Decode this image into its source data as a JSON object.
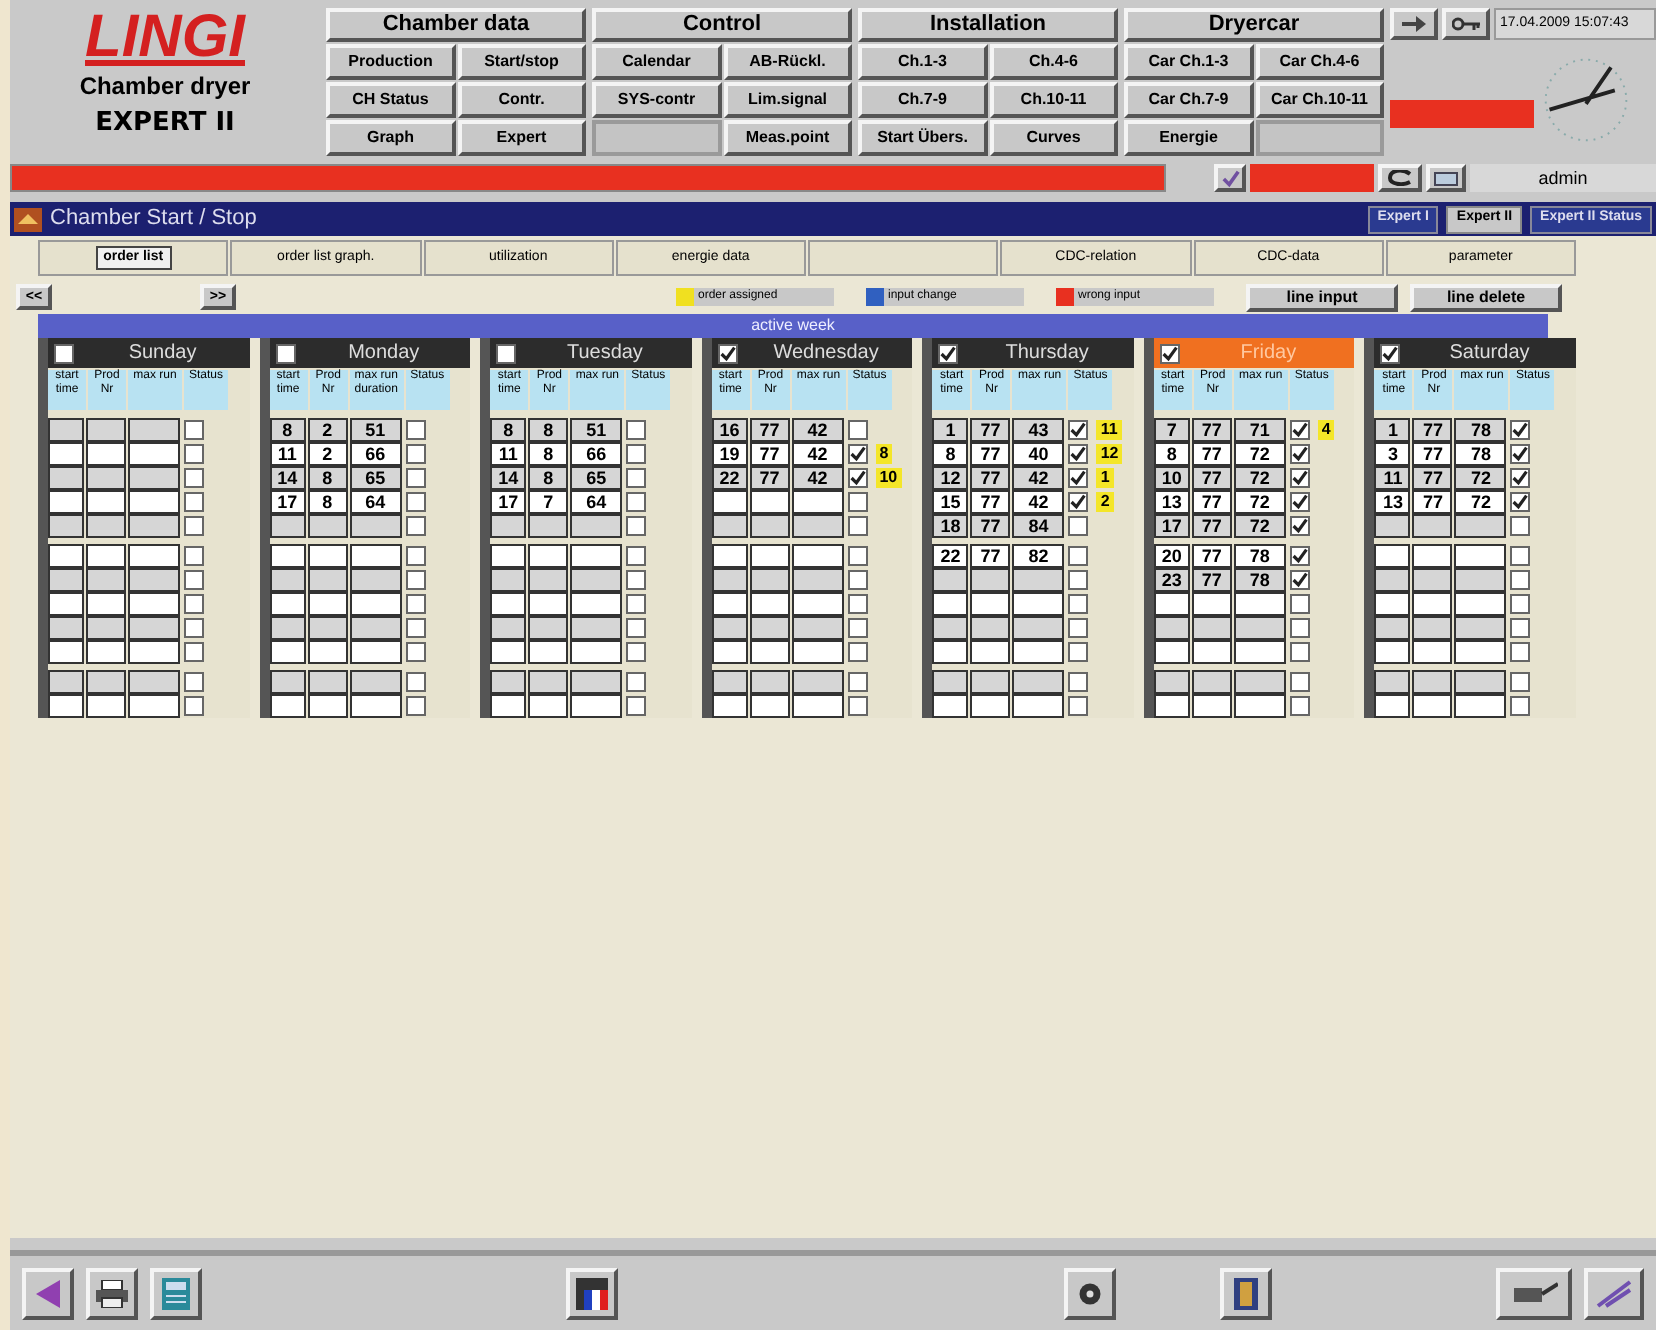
{
  "logo": {
    "brand": "LINGI",
    "subtitle": "Chamber dryer",
    "product": "EXPERT II"
  },
  "menu_groups": [
    {
      "title": "Chamber data",
      "buttons": [
        {
          "label": "Production",
          "disabled": false
        },
        {
          "label": "Start/stop",
          "disabled": false
        },
        {
          "label": "CH Status",
          "disabled": false
        },
        {
          "label": "Contr.",
          "disabled": false
        },
        {
          "label": "Graph",
          "disabled": false
        },
        {
          "label": "Expert",
          "disabled": false
        }
      ]
    },
    {
      "title": "Control",
      "buttons": [
        {
          "label": "Calendar",
          "disabled": false
        },
        {
          "label": "AB-Rückl.",
          "disabled": false
        },
        {
          "label": "SYS-contr",
          "disabled": false
        },
        {
          "label": "Lim.signal",
          "disabled": false
        },
        {
          "disabled": true
        },
        {
          "label": "Meas.point",
          "disabled": false
        }
      ]
    },
    {
      "title": "Installation",
      "buttons": [
        {
          "label": "Ch.1-3",
          "disabled": false
        },
        {
          "label": "Ch.4-6",
          "disabled": false
        },
        {
          "label": "Ch.7-9",
          "disabled": false
        },
        {
          "label": "Ch.10-11",
          "disabled": false
        },
        {
          "label": "Start Übers.",
          "disabled": false
        },
        {
          "label": "Curves",
          "disabled": false
        }
      ]
    },
    {
      "title": "Dryercar",
      "buttons": [
        {
          "label": "Car Ch.1-3",
          "disabled": false
        },
        {
          "label": "Car Ch.4-6",
          "disabled": false
        },
        {
          "label": "Car Ch.7-9",
          "disabled": false
        },
        {
          "label": "Car Ch.10-11",
          "disabled": false
        },
        {
          "label": "Energie",
          "disabled": false
        },
        {
          "disabled": true
        }
      ]
    }
  ],
  "datetime": "17.04.2009 15:07:43",
  "user": "admin",
  "title_bar": {
    "title": "Chamber Start / Stop",
    "modes": [
      {
        "label": "Expert I",
        "selected": false
      },
      {
        "label": "Expert II",
        "selected": true
      },
      {
        "label": "Expert II Status",
        "selected": false
      }
    ]
  },
  "tabs": [
    {
      "label": "order list",
      "selected": true
    },
    {
      "label": "order list graph.",
      "selected": false
    },
    {
      "label": "utilization",
      "selected": false
    },
    {
      "label": "energie data",
      "selected": false
    },
    {
      "selected": false
    },
    {
      "label": "CDC-relation",
      "selected": false
    },
    {
      "label": "CDC-data",
      "selected": false
    },
    {
      "label": "parameter",
      "selected": false
    }
  ],
  "nav": {
    "prev": "<<",
    "next": ">>"
  },
  "legend": [
    {
      "label": "order assigned",
      "color": "#f0e020"
    },
    {
      "label": "input change",
      "color": "#3060c0"
    },
    {
      "label": "wrong input",
      "color": "#e83020"
    }
  ],
  "actions": [
    "line input",
    "line delete"
  ],
  "week_label": "active week",
  "days": [
    {
      "name": "Sunday",
      "checked": false,
      "selected": false,
      "columns": [
        "start time",
        "Prod Nr",
        "max run",
        "Status"
      ],
      "rows": [
        {
          "checked": false
        },
        {
          "checked": false
        },
        {
          "checked": false
        },
        {
          "checked": false
        },
        {
          "checked": false
        },
        {
          "checked": false
        },
        {
          "checked": false
        },
        {
          "checked": false
        },
        {
          "checked": false
        },
        {
          "checked": false
        },
        {
          "checked": false
        },
        {
          "checked": false
        }
      ]
    },
    {
      "name": "Monday",
      "checked": false,
      "selected": false,
      "columns": [
        "start time",
        "Prod Nr",
        "max run duration",
        "Status"
      ],
      "rows": [
        {
          "start": "8",
          "prod": "2",
          "max": "51",
          "checked": false
        },
        {
          "start": "11",
          "prod": "2",
          "max": "66",
          "checked": false
        },
        {
          "start": "14",
          "prod": "8",
          "max": "65",
          "checked": false
        },
        {
          "start": "17",
          "prod": "8",
          "max": "64",
          "checked": false
        },
        {
          "checked": false
        },
        {
          "checked": false
        },
        {
          "checked": false
        },
        {
          "checked": false
        },
        {
          "checked": false
        },
        {
          "checked": false
        },
        {
          "checked": false
        },
        {
          "checked": false
        }
      ]
    },
    {
      "name": "Tuesday",
      "checked": false,
      "selected": false,
      "columns": [
        "start time",
        "Prod Nr",
        "max run",
        "Status"
      ],
      "rows": [
        {
          "start": "8",
          "prod": "8",
          "max": "51",
          "checked": false
        },
        {
          "start": "11",
          "prod": "8",
          "max": "66",
          "checked": false
        },
        {
          "start": "14",
          "prod": "8",
          "max": "65",
          "checked": false
        },
        {
          "start": "17",
          "prod": "7",
          "max": "64",
          "checked": false
        },
        {
          "checked": false
        },
        {
          "checked": false
        },
        {
          "checked": false
        },
        {
          "checked": false
        },
        {
          "checked": false
        },
        {
          "checked": false
        },
        {
          "checked": false
        },
        {
          "checked": false
        }
      ]
    },
    {
      "name": "Wednesday",
      "checked": true,
      "selected": false,
      "columns": [
        "start time",
        "Prod Nr",
        "max run",
        "Status"
      ],
      "rows": [
        {
          "start": "16",
          "prod": "77",
          "max": "42",
          "checked": false
        },
        {
          "start": "19",
          "prod": "77",
          "max": "42",
          "checked": true,
          "badge": "8"
        },
        {
          "start": "22",
          "prod": "77",
          "max": "42",
          "checked": true,
          "badge": "10"
        },
        {
          "checked": false
        },
        {
          "checked": false
        },
        {
          "checked": false
        },
        {
          "checked": false
        },
        {
          "checked": false
        },
        {
          "checked": false
        },
        {
          "checked": false
        },
        {
          "checked": false
        },
        {
          "checked": false
        }
      ]
    },
    {
      "name": "Thursday",
      "checked": true,
      "selected": false,
      "columns": [
        "start time",
        "Prod Nr",
        "max run",
        "Status"
      ],
      "rows": [
        {
          "start": "1",
          "prod": "77",
          "max": "43",
          "checked": true,
          "badge": "11"
        },
        {
          "start": "8",
          "prod": "77",
          "max": "40",
          "checked": true,
          "badge": "12"
        },
        {
          "start": "12",
          "prod": "77",
          "max": "42",
          "checked": true,
          "badge": "1"
        },
        {
          "start": "15",
          "prod": "77",
          "max": "42",
          "checked": true,
          "badge": "2"
        },
        {
          "start": "18",
          "prod": "77",
          "max": "84",
          "checked": false
        },
        {
          "start": "22",
          "prod": "77",
          "max": "82",
          "checked": false
        },
        {
          "checked": false
        },
        {
          "checked": false
        },
        {
          "checked": false
        },
        {
          "checked": false
        },
        {
          "checked": false
        },
        {
          "checked": false
        }
      ]
    },
    {
      "name": "Friday",
      "checked": true,
      "selected": true,
      "columns": [
        "start time",
        "Prod Nr",
        "max run",
        "Status"
      ],
      "rows": [
        {
          "start": "7",
          "prod": "77",
          "max": "71",
          "checked": true,
          "badge": "4"
        },
        {
          "start": "8",
          "prod": "77",
          "max": "72",
          "checked": true
        },
        {
          "start": "10",
          "prod": "77",
          "max": "72",
          "checked": true
        },
        {
          "start": "13",
          "prod": "77",
          "max": "72",
          "checked": true
        },
        {
          "start": "17",
          "prod": "77",
          "max": "72",
          "checked": true
        },
        {
          "start": "20",
          "prod": "77",
          "max": "78",
          "checked": true
        },
        {
          "start": "23",
          "prod": "77",
          "max": "78",
          "checked": true
        },
        {
          "checked": false
        },
        {
          "checked": false
        },
        {
          "checked": false
        },
        {
          "checked": false
        },
        {
          "checked": false
        }
      ]
    },
    {
      "name": "Saturday",
      "checked": true,
      "selected": false,
      "columns": [
        "start time",
        "Prod Nr",
        "max run",
        "Status"
      ],
      "rows": [
        {
          "start": "1",
          "prod": "77",
          "max": "78",
          "checked": true
        },
        {
          "start": "3",
          "prod": "77",
          "max": "78",
          "checked": true
        },
        {
          "start": "11",
          "prod": "77",
          "max": "72",
          "checked": true
        },
        {
          "start": "13",
          "prod": "77",
          "max": "72",
          "checked": true
        },
        {
          "checked": false
        },
        {
          "checked": false
        },
        {
          "checked": false
        },
        {
          "checked": false
        },
        {
          "checked": false
        },
        {
          "checked": false
        },
        {
          "checked": false
        },
        {
          "checked": false
        }
      ]
    }
  ]
}
